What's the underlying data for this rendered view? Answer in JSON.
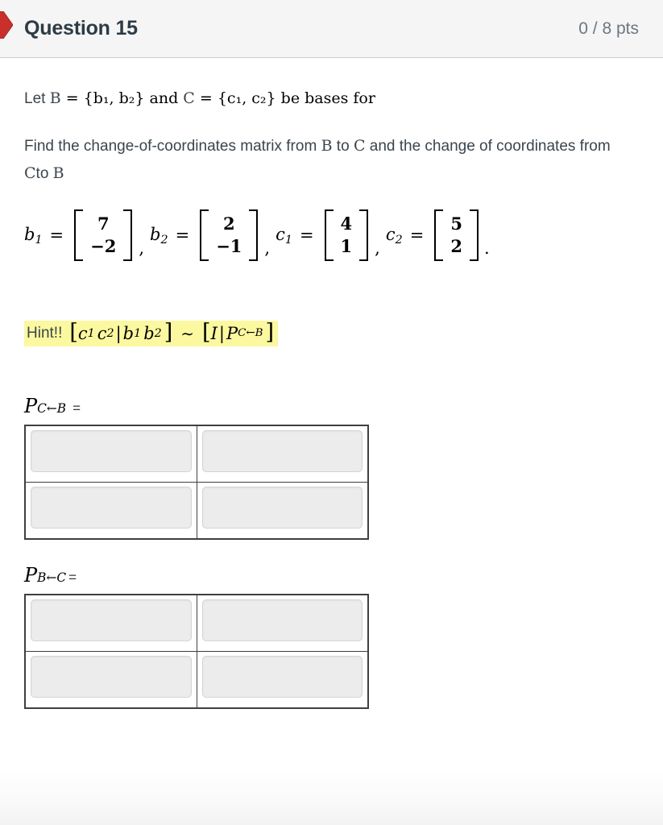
{
  "header": {
    "flag_icon": "red-flag-marker-icon",
    "question_name": "Question 15",
    "points": "0 / 8 pts",
    "accent_color": "#c9302c",
    "background_color": "#f5f5f5"
  },
  "question": {
    "line1": {
      "prefix": "Let ",
      "set_b": "B",
      "eq1": " = {b₁, b₂} and ",
      "set_c": "C",
      "eq2": " = {c₁, c₂} be bases for",
      "full_text": "Let B = {b1, b2} and C = {c1, c2} be bases for"
    },
    "line2": {
      "part1": "Find the change-of-coordinates matrix from ",
      "b": "B",
      "part2": " to ",
      "c": "C",
      "part3": " and the change of coordinates from ",
      "c2": "C",
      "part4": "to ",
      "b2": "B",
      "full_text": "Find the change-of-coordinates matrix from B to C and the change of coordinates from C to B"
    }
  },
  "vectors": [
    {
      "label": "b",
      "index": "1",
      "values": [
        "7",
        "−2"
      ],
      "separator": ","
    },
    {
      "label": "b",
      "index": "2",
      "values": [
        "2",
        "−1"
      ],
      "separator": ","
    },
    {
      "label": "c",
      "index": "1",
      "values": [
        "4",
        "1"
      ],
      "separator": ","
    },
    {
      "label": "c",
      "index": "2",
      "values": [
        "5",
        "2"
      ],
      "separator": "."
    }
  ],
  "hint": {
    "word": "Hint!!",
    "highlight_color": "#fbf8a0",
    "math": {
      "left_bracket": "[",
      "c1": "c",
      "c1_sub": "1",
      "c2": "c",
      "c2_sub": "2",
      "divider": "|",
      "b1": "b",
      "b1_sub": "1",
      "b2": "b",
      "b2_sub": "2",
      "right_bracket": "]",
      "relation": "∼",
      "left_bracket2": "[",
      "identity": "I",
      "divider2": "|",
      "p": "P",
      "p_sub": "C←B",
      "right_bracket2": "]"
    },
    "plain_text": "Hint!! [ c1 c2 | b1 b2 ] ~ [ I | P C←B ]"
  },
  "answers": [
    {
      "label_p": "P",
      "label_sub": "C←B",
      "label_eq": "=",
      "rows": [
        [
          {
            "value": "",
            "placeholder": ""
          },
          {
            "value": "",
            "placeholder": ""
          }
        ],
        [
          {
            "value": "",
            "placeholder": ""
          },
          {
            "value": "",
            "placeholder": ""
          }
        ]
      ]
    },
    {
      "label_p": "P",
      "label_sub": "B←C",
      "label_eq": "=",
      "rows": [
        [
          {
            "value": "",
            "placeholder": ""
          },
          {
            "value": "",
            "placeholder": ""
          }
        ],
        [
          {
            "value": "",
            "placeholder": ""
          },
          {
            "value": "",
            "placeholder": ""
          }
        ]
      ]
    }
  ]
}
